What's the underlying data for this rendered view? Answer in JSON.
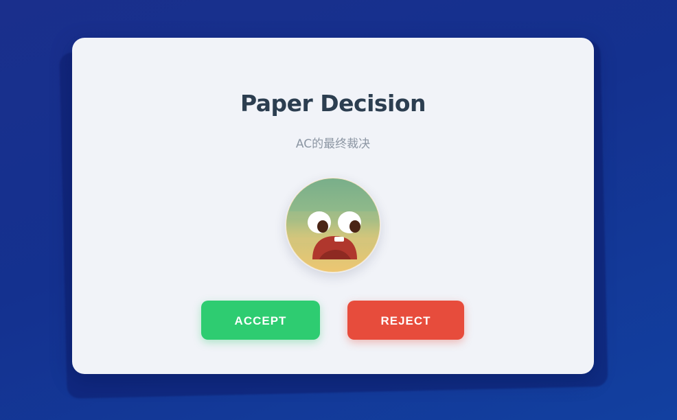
{
  "card": {
    "title": "Paper Decision",
    "subtitle": "AC的最终裁决"
  },
  "avatar": {
    "icon": "shocked-face-icon",
    "description_colors": {
      "face_top": "#7eb08a",
      "face_bottom": "#e9c471",
      "mouth": "#b0372d"
    }
  },
  "buttons": {
    "accept_label": "ACCEPT",
    "reject_label": "REJECT"
  },
  "colors": {
    "background": "#1a3291",
    "card": "#f1f3f8",
    "title": "#2c3e50",
    "subtitle": "#8c96a3",
    "accept": "#2ecc71",
    "reject": "#e74c3c"
  }
}
